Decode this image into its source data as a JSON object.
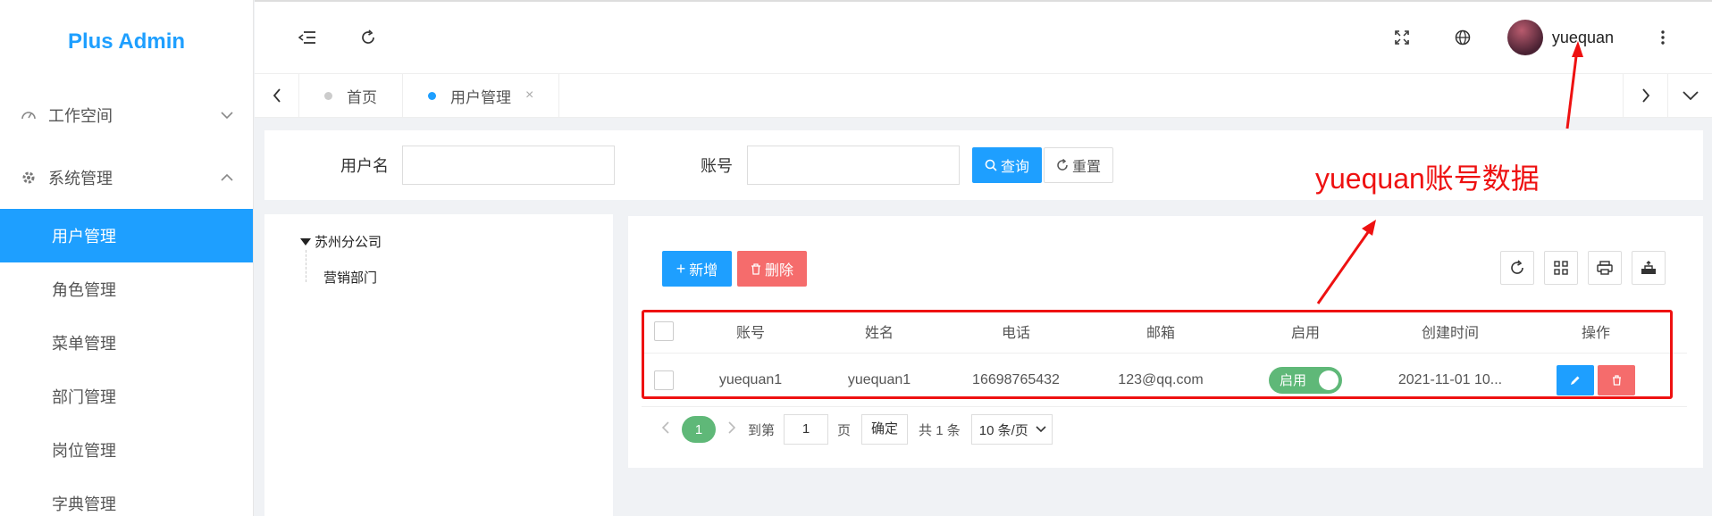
{
  "sidebar": {
    "logo": "Plus Admin",
    "groups": [
      {
        "label": "工作空间",
        "icon": "dashboard-icon",
        "expanded": false
      },
      {
        "label": "系统管理",
        "icon": "gear-icon",
        "expanded": true
      }
    ],
    "items": [
      {
        "label": "用户管理",
        "active": true
      },
      {
        "label": "角色管理"
      },
      {
        "label": "菜单管理"
      },
      {
        "label": "部门管理"
      },
      {
        "label": "岗位管理"
      },
      {
        "label": "字典管理"
      }
    ]
  },
  "header": {
    "icons": [
      "collapse-menu-icon",
      "refresh-icon",
      "fullscreen-icon",
      "globe-icon",
      "more-vertical-icon"
    ],
    "username": "yuequan"
  },
  "tabs": [
    {
      "label": "首页",
      "active": false
    },
    {
      "label": "用户管理",
      "active": true,
      "close": "×"
    }
  ],
  "search": {
    "username_label": "用户名",
    "username_value": "",
    "account_label": "账号",
    "account_value": "",
    "query_button": "查询",
    "reset_button": "重置"
  },
  "tree": {
    "root": "苏州分公司",
    "children": [
      "营销部门"
    ]
  },
  "toolbar": {
    "add_button": "新增",
    "delete_button": "删除",
    "tools": [
      "refresh-icon",
      "columns-icon",
      "print-icon",
      "export-icon"
    ]
  },
  "table": {
    "columns": [
      "账号",
      "姓名",
      "电话",
      "邮箱",
      "启用",
      "创建时间",
      "操作"
    ],
    "rows": [
      {
        "account": "yuequan1",
        "name": "yuequan1",
        "phone": "16698765432",
        "email": "123@qq.com",
        "enabled_label": "启用",
        "enabled": true,
        "created": "2021-11-01 10..."
      }
    ]
  },
  "pagination": {
    "current": "1",
    "goto_label": "到第",
    "goto_value": "1",
    "page_unit": "页",
    "confirm": "确定",
    "total": "共 1 条",
    "page_size": "10 条/页"
  },
  "annotation": {
    "text": "yuequan账号数据",
    "color": "#ee1111"
  },
  "colors": {
    "accent": "#1e9fff",
    "success": "#5fb878",
    "danger": "#f56c6c"
  }
}
